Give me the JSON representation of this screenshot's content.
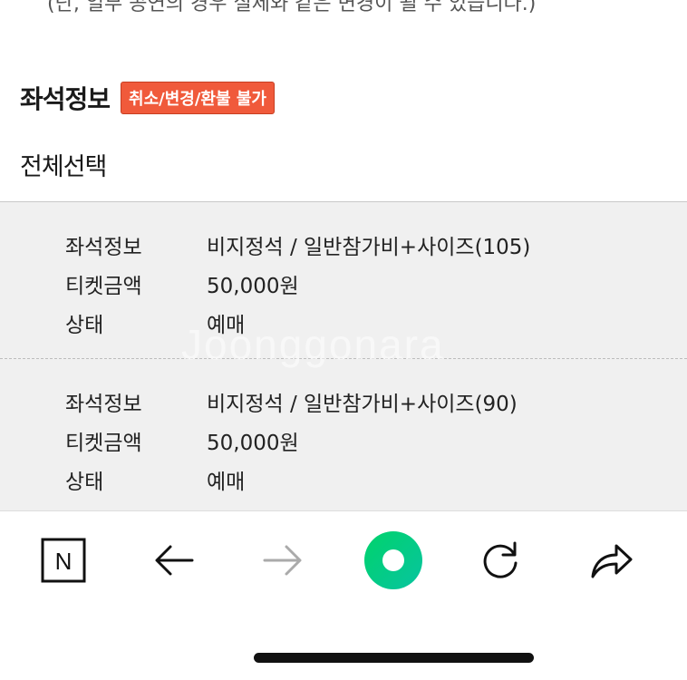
{
  "top_notice": "(단, 일부 공연의 경우 실제와 같은 변경이 될 수 있습니다.)",
  "section": {
    "title": "좌석정보",
    "badge": "취소/변경/환불 불가",
    "select_all": "전체선택"
  },
  "watermark": "Joonggonara",
  "seats": [
    {
      "seat_label": "좌석정보",
      "seat_value": "비지정석 / 일반참가비+사이즈(105)",
      "price_label": "티켓금액",
      "price_value": "50,000원",
      "status_label": "상태",
      "status_value": "예매"
    },
    {
      "seat_label": "좌석정보",
      "seat_value": "비지정석 / 일반참가비+사이즈(90)",
      "price_label": "티켓금액",
      "price_value": "50,000원",
      "status_label": "상태",
      "status_value": "예매"
    }
  ],
  "toolbar": {
    "home_icon_letter": "N",
    "icons": [
      "naver-home-icon",
      "back-arrow-icon",
      "forward-arrow-icon",
      "green-dot-icon",
      "reload-icon",
      "share-icon"
    ],
    "accent": "#1ec800"
  }
}
